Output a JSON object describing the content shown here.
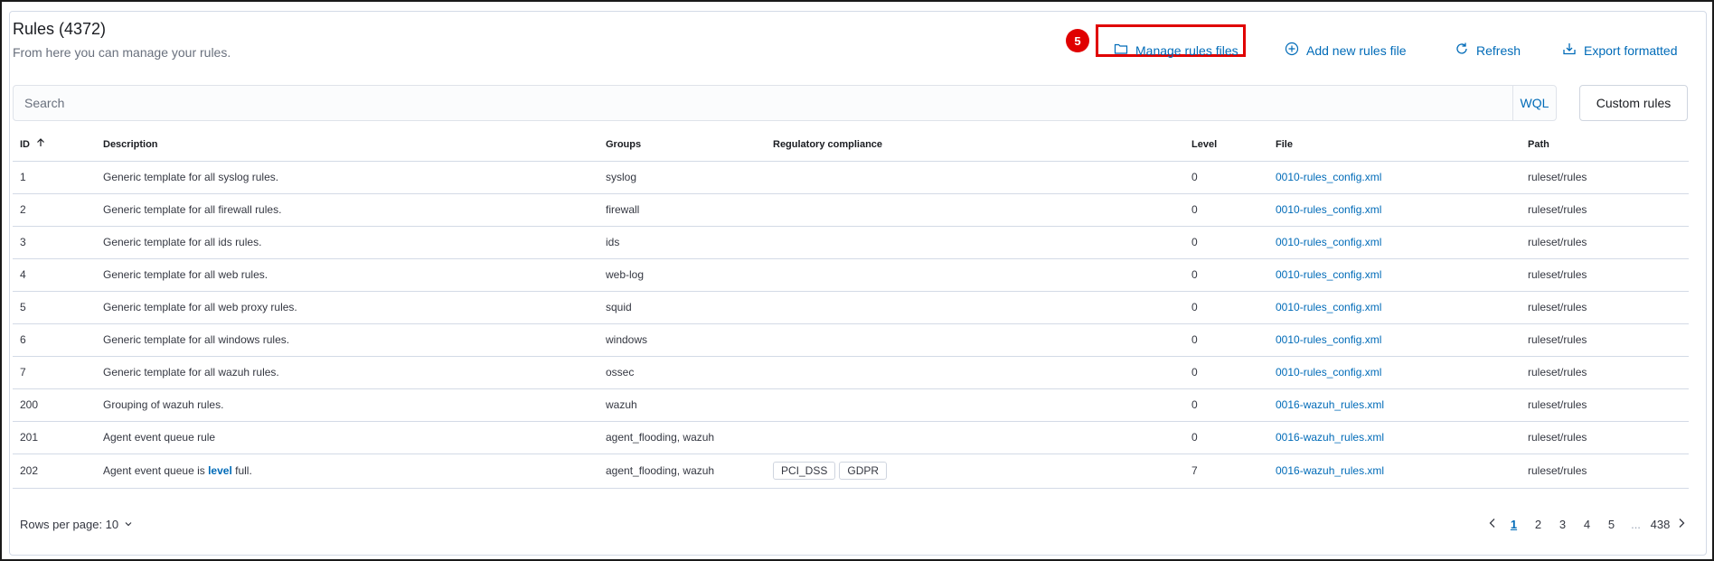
{
  "header": {
    "title": "Rules (4372)",
    "subtitle": "From here you can manage your rules."
  },
  "step_badge": "5",
  "actions": {
    "manage": "Manage rules files",
    "add": "Add new rules file",
    "refresh": "Refresh",
    "export": "Export formatted"
  },
  "search": {
    "placeholder": "Search",
    "wql": "WQL"
  },
  "custom_rules": "Custom rules",
  "columns": [
    "ID",
    "Description",
    "Groups",
    "Regulatory compliance",
    "Level",
    "File",
    "Path"
  ],
  "rows": [
    {
      "id": "1",
      "desc": "Generic template for all syslog rules.",
      "groups": "syslog",
      "level": "0",
      "file": "0010-rules_config.xml",
      "path": "ruleset/rules"
    },
    {
      "id": "2",
      "desc": "Generic template for all firewall rules.",
      "groups": "firewall",
      "level": "0",
      "file": "0010-rules_config.xml",
      "path": "ruleset/rules"
    },
    {
      "id": "3",
      "desc": "Generic template for all ids rules.",
      "groups": "ids",
      "level": "0",
      "file": "0010-rules_config.xml",
      "path": "ruleset/rules"
    },
    {
      "id": "4",
      "desc": "Generic template for all web rules.",
      "groups": "web-log",
      "level": "0",
      "file": "0010-rules_config.xml",
      "path": "ruleset/rules"
    },
    {
      "id": "5",
      "desc": "Generic template for all web proxy rules.",
      "groups": "squid",
      "level": "0",
      "file": "0010-rules_config.xml",
      "path": "ruleset/rules"
    },
    {
      "id": "6",
      "desc": "Generic template for all windows rules.",
      "groups": "windows",
      "level": "0",
      "file": "0010-rules_config.xml",
      "path": "ruleset/rules"
    },
    {
      "id": "7",
      "desc": "Generic template for all wazuh rules.",
      "groups": "ossec",
      "level": "0",
      "file": "0010-rules_config.xml",
      "path": "ruleset/rules"
    },
    {
      "id": "200",
      "desc": "Grouping of wazuh rules.",
      "groups": "wazuh",
      "level": "0",
      "file": "0016-wazuh_rules.xml",
      "path": "ruleset/rules"
    },
    {
      "id": "201",
      "desc": "Agent event queue rule",
      "groups": "agent_flooding, wazuh",
      "level": "0",
      "file": "0016-wazuh_rules.xml",
      "path": "ruleset/rules"
    }
  ],
  "last_row": {
    "id": "202",
    "desc_pre": "Agent event queue is ",
    "desc_hl": "level",
    "desc_post": " full.",
    "groups": "agent_flooding, wazuh",
    "tags": [
      "PCI_DSS",
      "GDPR"
    ],
    "level": "7",
    "file": "0016-wazuh_rules.xml",
    "path": "ruleset/rules"
  },
  "footer": {
    "rows_per_page": "Rows per page: 10",
    "pages": [
      "1",
      "2",
      "3",
      "4",
      "5",
      "...",
      "438"
    ],
    "current_page": "1"
  }
}
